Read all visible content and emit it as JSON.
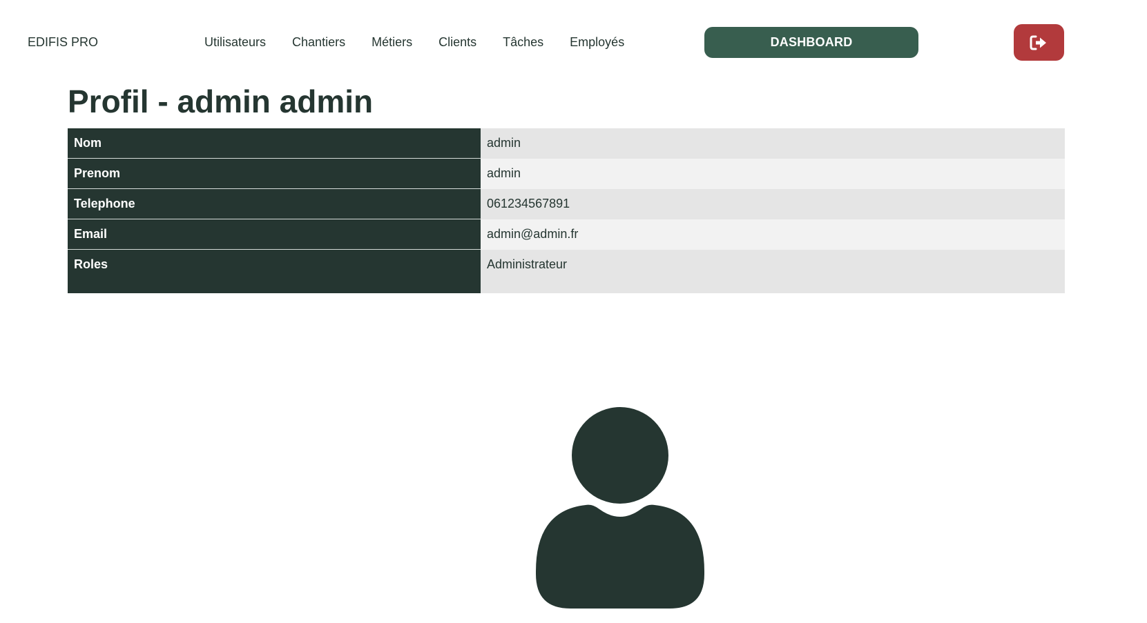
{
  "navbar": {
    "brand": "EDIFIS PRO",
    "links": [
      {
        "label": "Utilisateurs"
      },
      {
        "label": "Chantiers"
      },
      {
        "label": "Métiers"
      },
      {
        "label": "Clients"
      },
      {
        "label": "Tâches"
      },
      {
        "label": "Employés"
      }
    ],
    "dashboard_label": "DASHBOARD",
    "logout_icon": "sign-out-icon"
  },
  "page": {
    "title": "Profil - admin admin"
  },
  "profile": {
    "rows": [
      {
        "label": "Nom",
        "value": "admin"
      },
      {
        "label": "Prenom",
        "value": "admin"
      },
      {
        "label": "Telephone",
        "value": "061234567891"
      },
      {
        "label": "Email",
        "value": "admin@admin.fr"
      },
      {
        "label": "Roles",
        "value": "Administrateur"
      }
    ]
  },
  "avatar": {
    "icon": "user-icon"
  },
  "colors": {
    "primary_dark": "#253631",
    "dashboard_green": "#385e4f",
    "logout_red": "#b23a3c",
    "row_odd": "#e5e5e5",
    "row_even": "#f2f2f2"
  }
}
